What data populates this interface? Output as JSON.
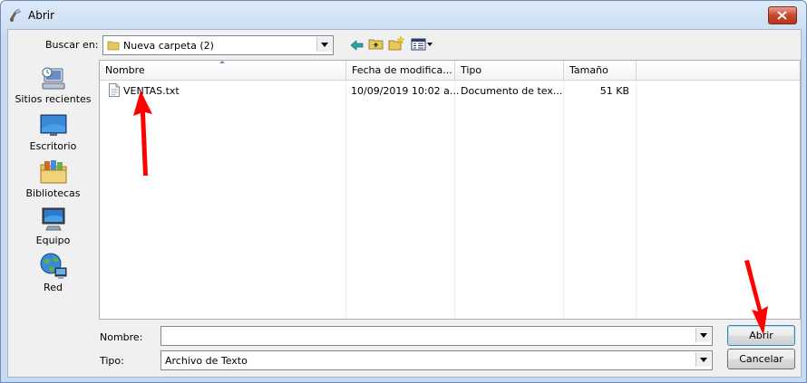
{
  "window": {
    "title": "Abrir",
    "close_icon": "close-icon"
  },
  "toolbar": {
    "look_in_label": "Buscar en:",
    "look_in_value": "Nueva carpeta (2)",
    "icons": [
      "back-icon",
      "up-folder-icon",
      "new-folder-icon",
      "view-menu-icon"
    ]
  },
  "places": [
    {
      "label": "Sitios recientes",
      "icon": "recent-places-icon"
    },
    {
      "label": "Escritorio",
      "icon": "desktop-icon"
    },
    {
      "label": "Bibliotecas",
      "icon": "libraries-icon"
    },
    {
      "label": "Equipo",
      "icon": "computer-icon"
    },
    {
      "label": "Red",
      "icon": "network-icon"
    }
  ],
  "file_list": {
    "columns": [
      "Nombre",
      "Fecha de modifica...",
      "Tipo",
      "Tamaño"
    ],
    "rows": [
      {
        "name": "VENTAS.txt",
        "modified": "10/09/2019 10:02 a...",
        "type": "Documento de tex...",
        "size": "51 KB"
      }
    ]
  },
  "footer": {
    "filename_label": "Nombre:",
    "filename_value": "",
    "filetype_label": "Tipo:",
    "filetype_value": "Archivo de Texto",
    "open_label": "Abrir",
    "cancel_label": "Cancelar"
  },
  "annotations": {
    "arrow_color": "#ff0000"
  }
}
